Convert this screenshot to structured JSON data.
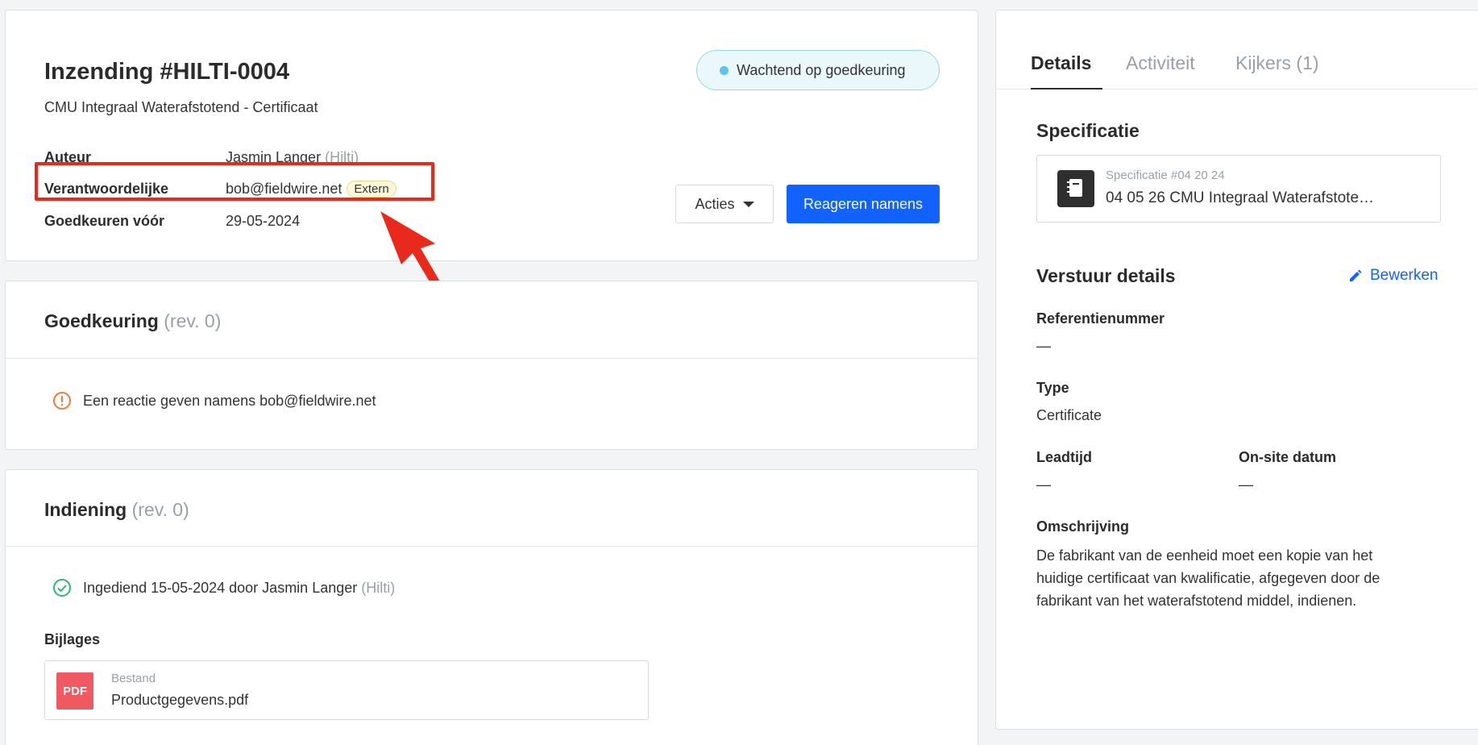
{
  "header": {
    "title": "Inzending #HILTI-0004",
    "subtitle": "CMU Integraal Waterafstotend - Certificaat",
    "status": "Wachtend op goedkeuring",
    "meta": {
      "author_label": "Auteur",
      "author_name": "Jasmin Langer",
      "author_company": "(Hilti)",
      "responsible_label": "Verantwoordelijke",
      "responsible_value": "bob@fieldwire.net",
      "responsible_badge": "Extern",
      "due_label": "Goedkeuren vóór",
      "due_value": "29-05-2024"
    },
    "actions_label": "Acties",
    "respond_label": "Reageren namens"
  },
  "approval": {
    "title": "Goedkeuring",
    "rev": "(rev. 0)",
    "message": "Een reactie geven namens bob@fieldwire.net"
  },
  "submission": {
    "title": "Indiening",
    "rev": "(rev. 0)",
    "submitted_text": "Ingediend 15-05-2024 door Jasmin Langer",
    "submitted_company": "(Hilti)",
    "attachments_label": "Bijlages",
    "file_kind": "Bestand",
    "file_name": "Productgegevens.pdf",
    "file_icon_text": "PDF"
  },
  "right_panel": {
    "tabs": [
      {
        "label": "Details"
      },
      {
        "label": "Activiteit"
      },
      {
        "label": "Kijkers"
      }
    ],
    "viewers_count": "(1)",
    "spec_title": "Specificatie",
    "spec_kind": "Specificatie #04 20 24",
    "spec_name": "04 05 26 CMU Integraal Waterafstote…",
    "send_details_title": "Verstuur details",
    "edit_label": "Bewerken",
    "fields": {
      "reference_label": "Referentienummer",
      "reference_value": "—",
      "type_label": "Type",
      "type_value": "Certificate",
      "leadtime_label": "Leadtijd",
      "leadtime_value": "—",
      "onsite_label": "On-site datum",
      "onsite_value": "—",
      "description_label": "Omschrijving",
      "description_value": "De fabrikant van de eenheid moet een kopie van het huidige certificaat van kwalificatie, afgegeven door de fabrikant van het waterafstotend middel, indienen."
    }
  },
  "colors": {
    "primary": "#1262ff",
    "highlight": "#e8291c",
    "status_dot": "#5ec3e6",
    "warning": "#f07a3a",
    "success": "#2eb872",
    "pdf": "#ef5a62"
  },
  "icons": [
    "status-dot-icon",
    "caret-down-icon",
    "warning-circle-icon",
    "check-circle-icon",
    "pdf-icon",
    "spec-book-icon",
    "pencil-icon",
    "annotation-arrow"
  ]
}
